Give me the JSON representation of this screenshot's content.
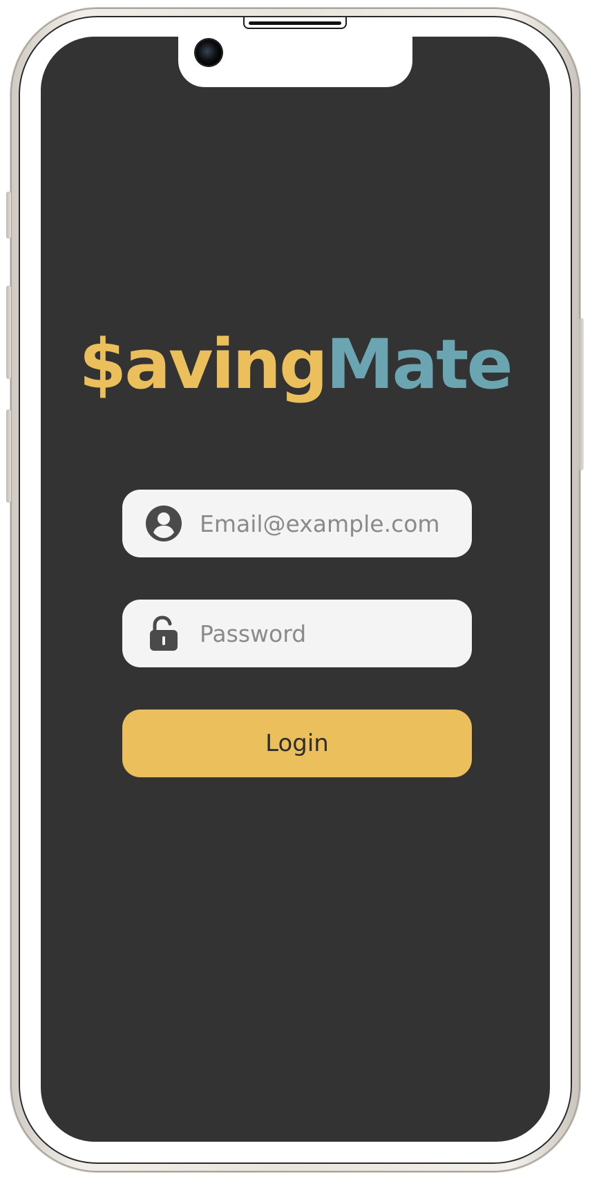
{
  "app": {
    "logo_part1": "$aving",
    "logo_part2": "Mate"
  },
  "login_form": {
    "email": {
      "placeholder": "Email@example.com",
      "value": "",
      "icon": "account-circle-icon"
    },
    "password": {
      "placeholder": "Password",
      "value": "",
      "icon": "lock-open-icon"
    },
    "login_label": "Login"
  },
  "colors": {
    "screen_background": "#333333",
    "accent_yellow": "#ebbf5b",
    "accent_teal": "#6aa5b1",
    "field_background": "#f4f4f4",
    "icon_color": "#4a4a4a"
  }
}
